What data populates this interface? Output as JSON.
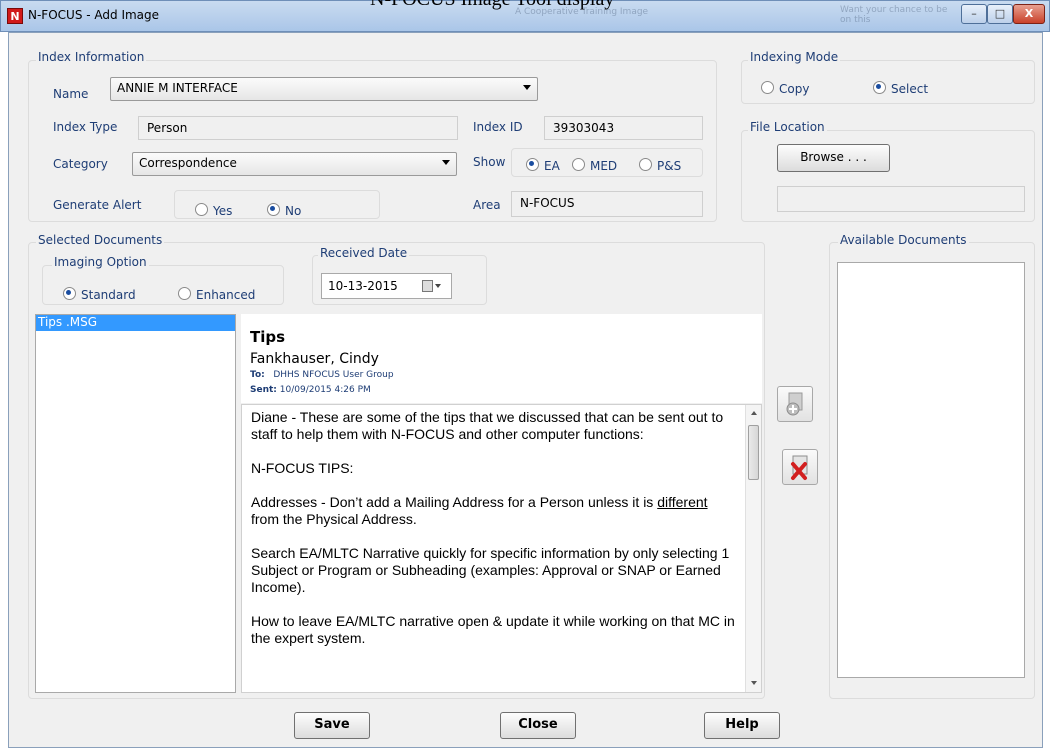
{
  "window": {
    "title": "N-FOCUS - Add Image",
    "app_icon_letter": "N",
    "background_caption": "N-FOCUS Image  Tool  display",
    "background_tab_1": "A Cooperative Training Image",
    "background_tab_2": "Want your chance to be on this",
    "minimize": "–",
    "maximize": "□",
    "close": "X"
  },
  "index_info": {
    "group_label": "Index Information",
    "name_label": "Name",
    "name_value": "ANNIE M INTERFACE",
    "index_type_label": "Index Type",
    "index_type_value": "Person",
    "index_id_label": "Index ID",
    "index_id_value": "39303043",
    "category_label": "Category",
    "category_value": "Correspondence",
    "show_label": "Show",
    "show_options": [
      "EA",
      "MED",
      "P&S"
    ],
    "show_selected": "EA",
    "generate_alert_label": "Generate Alert",
    "alert_options": [
      "Yes",
      "No"
    ],
    "alert_selected": "No",
    "area_label": "Area",
    "area_value": "N-FOCUS"
  },
  "indexing_mode": {
    "group_label": "Indexing Mode",
    "options": [
      "Copy",
      "Select"
    ],
    "selected": "Select"
  },
  "file_location": {
    "group_label": "File Location",
    "browse_label": "Browse . . .",
    "path_value": ""
  },
  "selected_documents": {
    "group_label": "Selected Documents",
    "imaging_option_label": "Imaging Option",
    "imaging_options": [
      "Standard",
      "Enhanced"
    ],
    "imaging_selected": "Standard",
    "received_date_label": "Received Date",
    "received_date_value": "10-13-2015",
    "files": [
      "Tips .MSG"
    ]
  },
  "message": {
    "subject": "Tips",
    "from": "Fankhauser, Cindy",
    "to_label": "To:",
    "to_value": "DHHS NFOCUS User Group",
    "sent_label": "Sent:",
    "sent_value": "10/09/2015 4:26 PM",
    "paragraphs": [
      "Diane - These are some of the tips that we discussed that can be sent out to staff to help them with N-FOCUS and other computer functions:",
      "N-FOCUS TIPS:",
      "Search EA/MLTC Narrative quickly for specific information by only selecting 1 Subject or Program or Subheading (examples: Approval or SNAP or Earned Income).",
      "How to leave EA/MLTC narrative open & update it while working on that MC in the expert system."
    ],
    "addresses_tip_before": "Addresses - Don’t add a Mailing Address for a Person unless it is ",
    "addresses_tip_underlined": "different ",
    "addresses_tip_after": "from the Physical Address."
  },
  "available_documents": {
    "group_label": "Available Documents"
  },
  "buttons": {
    "save": "Save",
    "close": "Close",
    "help": "Help"
  }
}
